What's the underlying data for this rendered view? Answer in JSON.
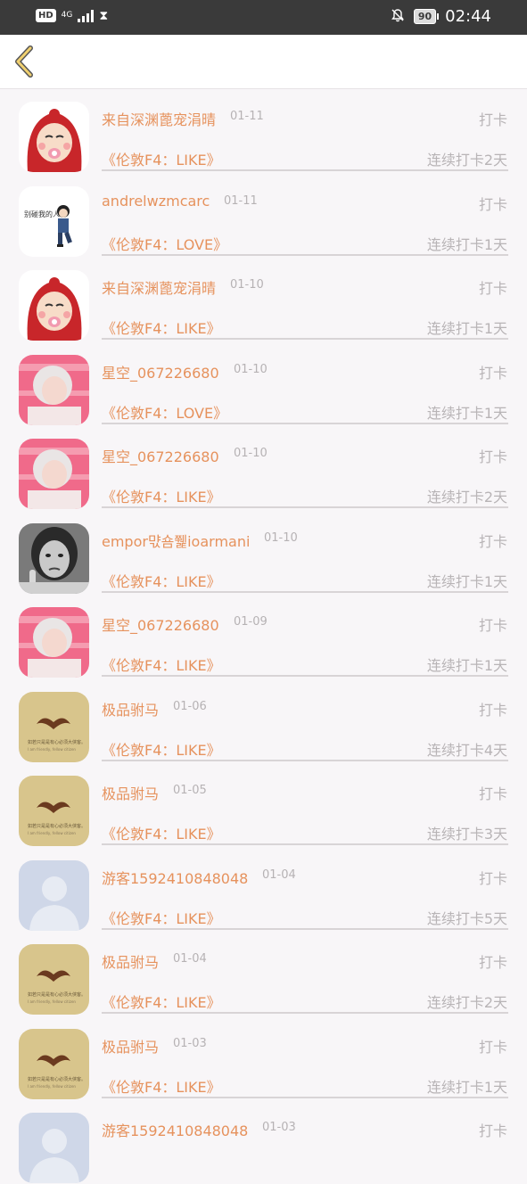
{
  "status_bar": {
    "hd": "HD",
    "network": "4G",
    "battery": "90",
    "time": "02:44",
    "icons": [
      "hd-icon",
      "signal-icon",
      "hourglass-icon",
      "bell-off-icon",
      "battery-icon"
    ]
  },
  "nav": {
    "back_icon": "chevron-left-icon",
    "accent": "#f0d070"
  },
  "colors": {
    "name": "#e6925d",
    "muted": "#b8b4b6"
  },
  "rows": [
    {
      "user": "来自深渊蓖宠涓晴",
      "date": "01-11",
      "action": "打卡",
      "book": "《伦敦F4：LIKE》",
      "streak": "连续打卡2天",
      "avatar": "red-hood-cartoon"
    },
    {
      "user": "andrelwzmcarc",
      "date": "01-11",
      "action": "打卡",
      "book": "《伦敦F4：LOVE》",
      "streak": "连续打卡1天",
      "avatar": "boy-doodle"
    },
    {
      "user": "来自深渊蓖宠涓晴",
      "date": "01-10",
      "action": "打卡",
      "book": "《伦敦F4：LIKE》",
      "streak": "连续打卡1天",
      "avatar": "red-hood-cartoon"
    },
    {
      "user": "星空_067226680",
      "date": "01-10",
      "action": "打卡",
      "book": "《伦敦F4：LOVE》",
      "streak": "连续打卡1天",
      "avatar": "pink-photo"
    },
    {
      "user": "星空_067226680",
      "date": "01-10",
      "action": "打卡",
      "book": "《伦敦F4：LIKE》",
      "streak": "连续打卡2天",
      "avatar": "pink-photo"
    },
    {
      "user": "empor먃숌쮍ioarmani",
      "date": "01-10",
      "action": "打卡",
      "book": "《伦敦F4：LIKE》",
      "streak": "连续打卡1天",
      "avatar": "bw-girl"
    },
    {
      "user": "星空_067226680",
      "date": "01-09",
      "action": "打卡",
      "book": "《伦敦F4：LIKE》",
      "streak": "连续打卡1天",
      "avatar": "pink-photo"
    },
    {
      "user": "极品驸马",
      "date": "01-06",
      "action": "打卡",
      "book": "《伦敦F4：LIKE》",
      "streak": "连续打卡4天",
      "avatar": "mustache"
    },
    {
      "user": "极品驸马",
      "date": "01-05",
      "action": "打卡",
      "book": "《伦敦F4：LIKE》",
      "streak": "连续打卡3天",
      "avatar": "mustache"
    },
    {
      "user": "游客1592410848048",
      "date": "01-04",
      "action": "打卡",
      "book": "《伦敦F4：LIKE》",
      "streak": "连续打卡5天",
      "avatar": "default-user"
    },
    {
      "user": "极品驸马",
      "date": "01-04",
      "action": "打卡",
      "book": "《伦敦F4：LIKE》",
      "streak": "连续打卡2天",
      "avatar": "mustache"
    },
    {
      "user": "极品驸马",
      "date": "01-03",
      "action": "打卡",
      "book": "《伦敦F4：LIKE》",
      "streak": "连续打卡1天",
      "avatar": "mustache"
    },
    {
      "user": "游客1592410848048",
      "date": "01-03",
      "action": "打卡",
      "book": "",
      "streak": "",
      "avatar": "default-user"
    }
  ]
}
